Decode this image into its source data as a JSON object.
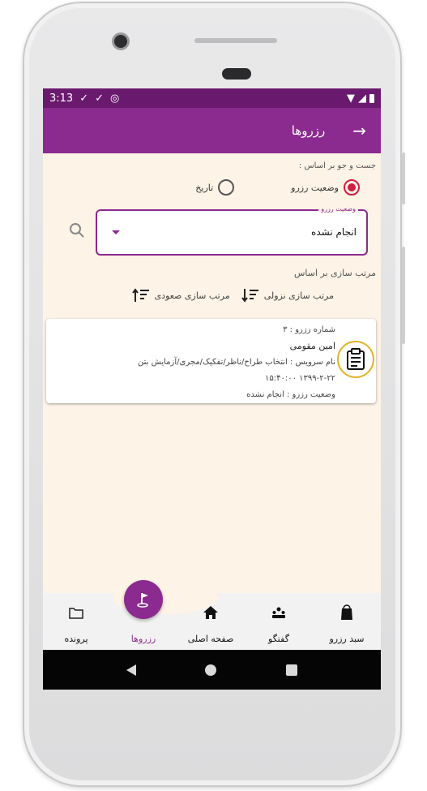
{
  "status": {
    "time": "3:13"
  },
  "appbar": {
    "title": "رزروها",
    "back_icon": "arrow-right-icon"
  },
  "search": {
    "label": "جست و جو بر اساس :",
    "options": [
      {
        "label": "وضعیت رزرو",
        "selected": true
      },
      {
        "label": "تاریخ",
        "selected": false
      }
    ],
    "select_legend": "وضعیت رزرو",
    "select_value": "انجام نشده"
  },
  "sort": {
    "title": "مرتب سازی بر اساس",
    "desc_label": "مرتب سازی نزولی",
    "asc_label": "مرتب سازی صعودی"
  },
  "reservations": [
    {
      "number": "شماره رزرو : ۳",
      "name": "امین مقومی",
      "service": "نام سرویس : انتخاب طراح/ناظر/تفکیک/مجری/آزمایش بتن",
      "datetime": "۱۳۹۹-۲-۲۲ ۱۵:۴۰:۰۰",
      "status": "وضعیت رزرو : انجام نشده"
    }
  ],
  "bottom_nav": {
    "cart": "سبد رزرو",
    "chat": "گفتگو",
    "home": "صفحه اصلی",
    "reservations": "رزروها",
    "files": "پرونده"
  },
  "colors": {
    "primary": "#8b2a8f",
    "statusbar": "#6a1a6e",
    "accent": "#d81b40",
    "background": "#fdf3e6"
  }
}
